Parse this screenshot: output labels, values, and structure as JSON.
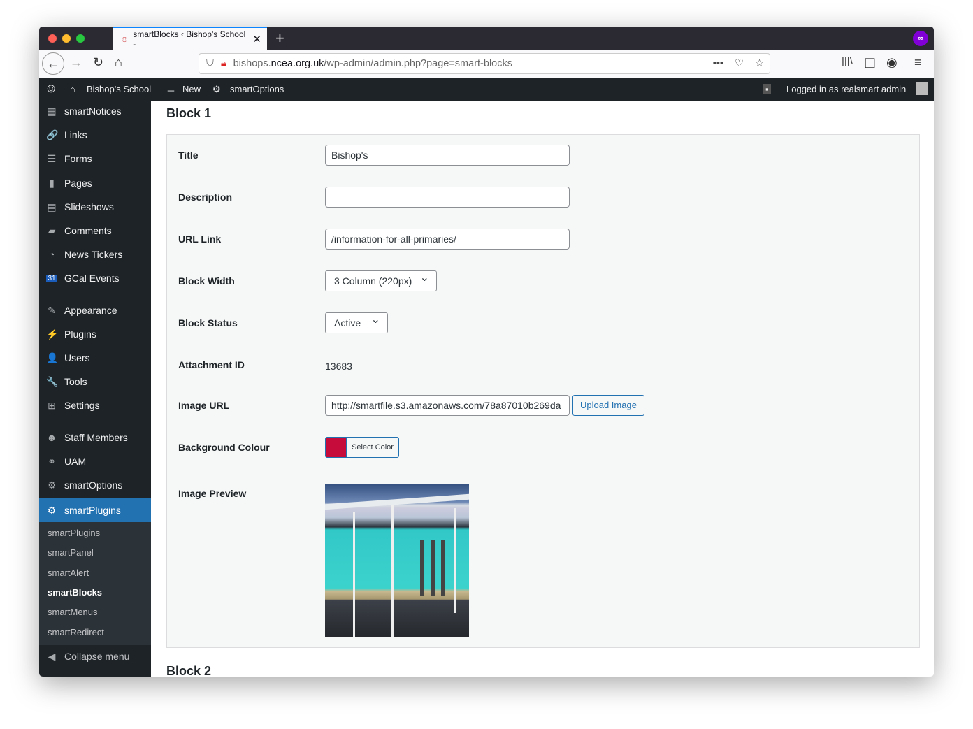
{
  "browser": {
    "tab_title": "smartBlocks ‹ Bishop's School -",
    "url_domain_pre": "bishops.",
    "url_domain": "ncea.org.uk",
    "url_path": "/wp-admin/admin.php?page=smart-blocks"
  },
  "adminbar": {
    "site": "Bishop's School",
    "new": "New",
    "options": "smartOptions",
    "user": "Logged in as realsmart admin"
  },
  "menu": [
    {
      "icon": "grid",
      "label": "smartNotices"
    },
    {
      "icon": "🔗",
      "label": "Links"
    },
    {
      "icon": "☰",
      "label": "Forms"
    },
    {
      "icon": "▮",
      "label": "Pages"
    },
    {
      "icon": "▤",
      "label": "Slideshows"
    },
    {
      "icon": "▰",
      "label": "Comments"
    },
    {
      "icon": "◔",
      "label": "News Tickers"
    },
    {
      "icon": "31",
      "label": "GCal Events"
    },
    {
      "icon": "✎",
      "label": "Appearance"
    },
    {
      "icon": "⚡",
      "label": "Plugins"
    },
    {
      "icon": "👤",
      "label": "Users"
    },
    {
      "icon": "🔧",
      "label": "Tools"
    },
    {
      "icon": "⊞",
      "label": "Settings"
    },
    {
      "icon": "☻",
      "label": "Staff Members"
    },
    {
      "icon": "⚭",
      "label": "UAM"
    },
    {
      "icon": "⚙",
      "label": "smartOptions"
    },
    {
      "icon": "⚙",
      "label": "smartPlugins"
    }
  ],
  "submenu": [
    "smartPlugins",
    "smartPanel",
    "smartAlert",
    "smartBlocks",
    "smartMenus",
    "smartRedirect"
  ],
  "collapse": "Collapse menu",
  "block1": {
    "heading": "Block 1",
    "title_label": "Title",
    "title": "Bishop's",
    "desc_label": "Description",
    "desc": "",
    "url_label": "URL Link",
    "url": "/information-for-all-primaries/",
    "width_label": "Block Width",
    "width": "3 Column (220px)",
    "status_label": "Block Status",
    "status": "Active",
    "att_label": "Attachment ID",
    "att": "13683",
    "img_label": "Image URL",
    "img": "http://smartfile.s3.amazonaws.com/78a87010b269da",
    "upload": "Upload Image",
    "bg_label": "Background Colour",
    "bg_color": "#c60c3b",
    "select_color": "Select Color",
    "preview_label": "Image Preview"
  },
  "block2": {
    "heading": "Block 2"
  }
}
